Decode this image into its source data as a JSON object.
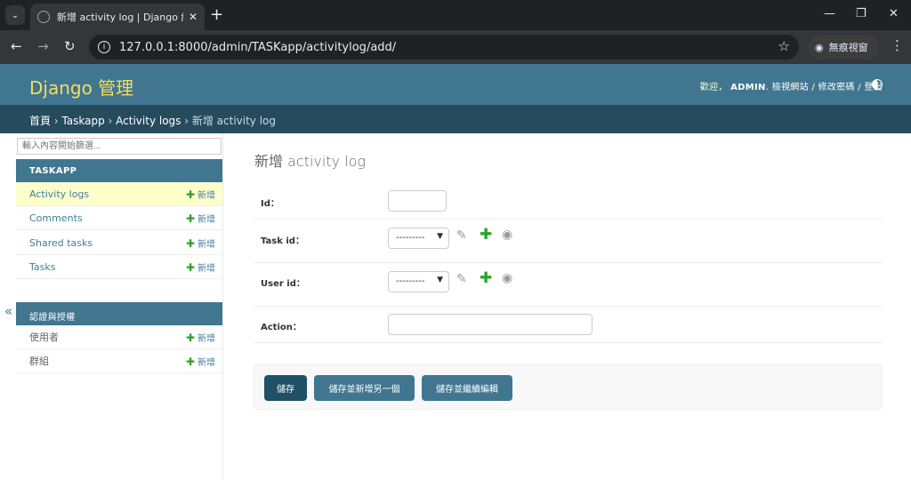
{
  "browser": {
    "tab_title": "新增 activity log | Django 網站管理",
    "url": "127.0.0.1:8000/admin/TASKapp/activitylog/add/",
    "incognito_label": "無痕視窗"
  },
  "header": {
    "branding": "Django 管理",
    "welcome": "歡迎，",
    "username": "ADMIN",
    "view_site": "檢視網站",
    "change_password": "修改密碼",
    "logout": "登出"
  },
  "breadcrumbs": {
    "home": "首頁",
    "app": "Taskapp",
    "model": "Activity logs",
    "current": "新增 activity log"
  },
  "sidebar": {
    "filter_placeholder": "輸入內容開始篩選...",
    "modules": [
      {
        "caption": "TASKAPP",
        "items": [
          {
            "label": "Activity logs",
            "add": "新增"
          },
          {
            "label": "Comments",
            "add": "新增"
          },
          {
            "label": "Shared tasks",
            "add": "新增"
          },
          {
            "label": "Tasks",
            "add": "新增"
          }
        ]
      },
      {
        "caption": "認證與授權",
        "items": [
          {
            "label": "使用者",
            "add": "新增"
          },
          {
            "label": "群組",
            "add": "新增"
          }
        ]
      }
    ]
  },
  "form": {
    "title": "新增 activity log",
    "fields": {
      "id": {
        "label": "Id：",
        "value": ""
      },
      "task_id": {
        "label": "Task id：",
        "selected": "---------"
      },
      "user_id": {
        "label": "User id：",
        "selected": "---------"
      },
      "action": {
        "label": "Action：",
        "value": ""
      }
    },
    "buttons": {
      "save": "儲存",
      "save_add_another": "儲存並新增另一個",
      "save_continue": "儲存並繼續編輯"
    }
  }
}
